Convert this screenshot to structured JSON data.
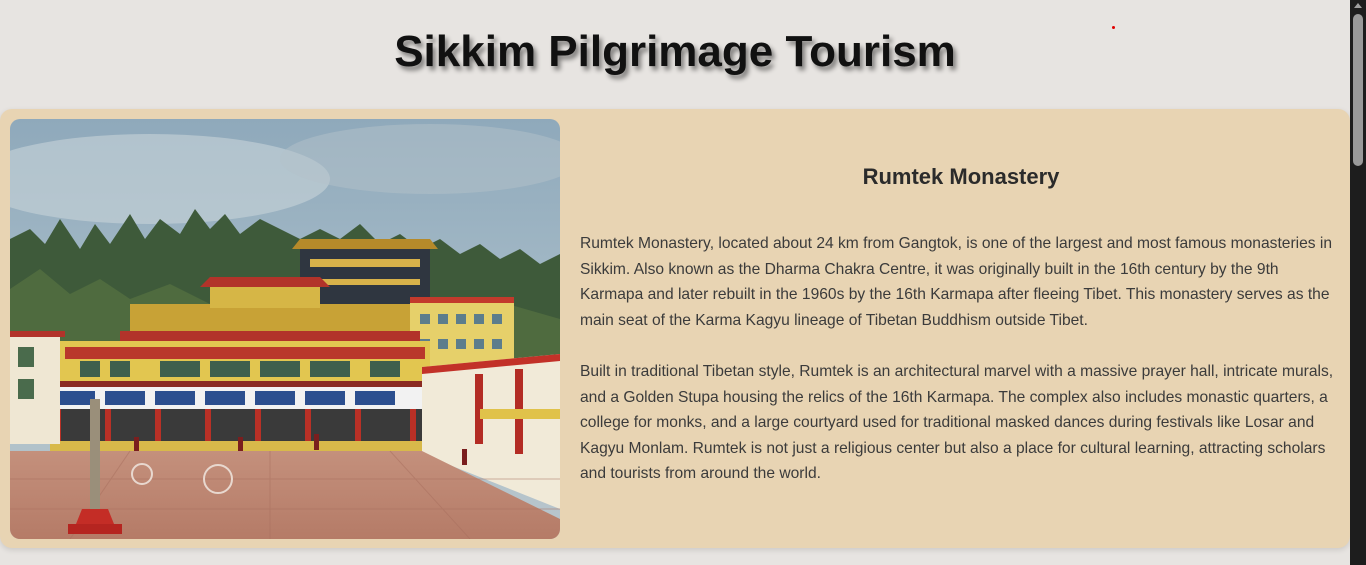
{
  "page": {
    "title": "Sikkim Pilgrimage Tourism"
  },
  "card": {
    "image_alt": "Rumtek Monastery",
    "heading": "Rumtek Monastery",
    "paragraphs": [
      "Rumtek Monastery, located about 24 km from Gangtok, is one of the largest and most famous monasteries in Sikkim. Also known as the Dharma Chakra Centre, it was originally built in the 16th century by the 9th Karmapa and later rebuilt in the 1960s by the 16th Karmapa after fleeing Tibet. This monastery serves as the main seat of the Karma Kagyu lineage of Tibetan Buddhism outside Tibet.",
      "Built in traditional Tibetan style, Rumtek is an architectural marvel with a massive prayer hall, intricate murals, and a Golden Stupa housing the relics of the 16th Karmapa. The complex also includes monastic quarters, a college for monks, and a large courtyard used for traditional masked dances during festivals like Losar and Kagyu Monlam. Rumtek is not just a religious center but also a place for cultural learning, attracting scholars and tourists from around the world."
    ]
  },
  "colors": {
    "page_background": "#e7e4e1",
    "card_background": "#e8d4b3",
    "heading_text": "#2b2b2b",
    "body_text": "#3b3b3b"
  },
  "icons": {
    "scroll_up": "scroll-up-arrow-icon"
  }
}
